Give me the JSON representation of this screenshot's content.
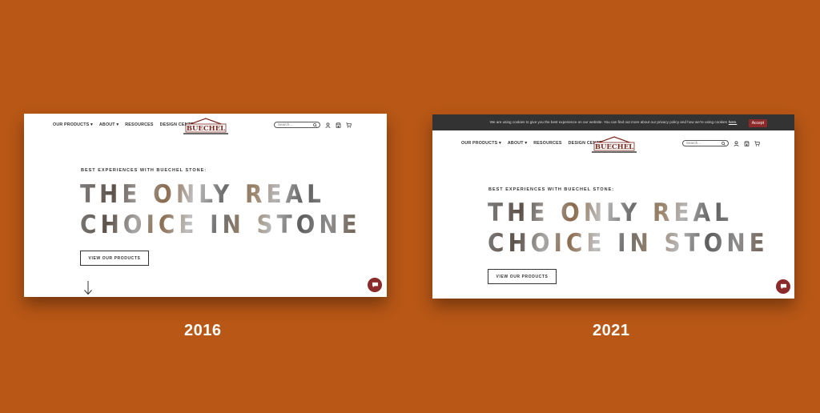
{
  "comparison": {
    "left_label": "2016",
    "right_label": "2021",
    "background_color": "#B85716"
  },
  "site": {
    "logo_text": "BUECHEL",
    "nav": {
      "our_products": "OUR PRODUCTS ▾",
      "about": "ABOUT ▾",
      "resources": "RESOURCES",
      "design_centers": "DESIGN CENTERS"
    },
    "search_placeholder": "Search...",
    "eyebrow": "BEST EXPERIENCES WITH BUECHEL STONE:",
    "headline_line1": "THE ONLY REAL",
    "headline_line2": "CHOICE IN STONE",
    "cta_label": "VIEW OUR PRODUCTS",
    "accent_color": "#8a2a2a"
  },
  "cookie_banner": {
    "text": "We are using cookies to give you the best experience on our website. You can find out more about our privacy policy and how we're using cookies",
    "link_text": "here.",
    "accept_label": "Accept"
  },
  "icons": [
    "search-icon",
    "user-icon",
    "store-icon",
    "cart-icon",
    "down-arrow-icon",
    "chat-icon"
  ]
}
